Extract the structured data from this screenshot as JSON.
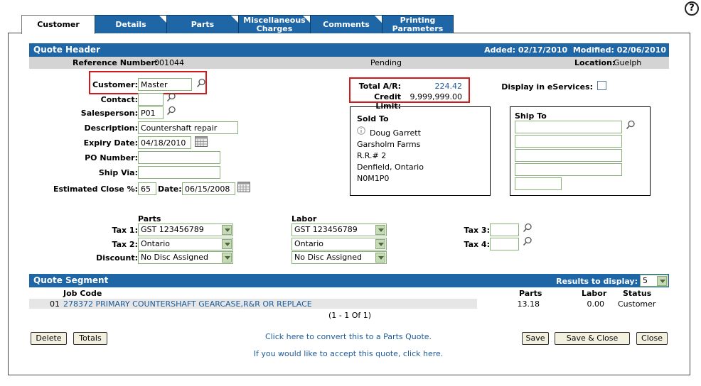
{
  "tabs": [
    {
      "label": "Customer"
    },
    {
      "label": "Details"
    },
    {
      "label": "Parts"
    },
    {
      "label": "Miscellaneous Charges"
    },
    {
      "label": "Comments"
    },
    {
      "label": "Printing Parameters"
    }
  ],
  "header": {
    "title": "Quote Header",
    "added_label": "Added:",
    "added_value": "02/17/2010",
    "modified_label": "Modified:",
    "modified_value": "02/06/2010",
    "reference_label": "Reference Number:",
    "reference_value": "001044",
    "status": "Pending",
    "location_label": "Location:",
    "location_value": "Guelph"
  },
  "form": {
    "customer_label": "Customer:",
    "customer_value": "Master",
    "contact_label": "Contact:",
    "contact_value": "",
    "salesperson_label": "Salesperson:",
    "salesperson_value": "P01",
    "description_label": "Description:",
    "description_value": "Countershaft repair",
    "expiry_label": "Expiry Date:",
    "expiry_value": "04/18/2010",
    "po_label": "PO Number:",
    "po_value": "",
    "shipvia_label": "Ship Via:",
    "shipvia_value": "",
    "estclose_label": "Estimated Close %:",
    "estclose_value": "65",
    "date_label": "Date:",
    "date_value": "06/15/2008"
  },
  "account": {
    "total_ar_label": "Total A/R:",
    "total_ar_value": "224.42",
    "credit_limit_label": "Credit Limit:",
    "credit_limit_value": "9,999,999.00",
    "eservices_label": "Display in eServices:"
  },
  "sold_to": {
    "title": "Sold To",
    "lines": [
      "Doug Garrett",
      "Garsholm Farms",
      "R.R.# 2",
      "Denfield, Ontario",
      "N0M1P0"
    ]
  },
  "ship_to": {
    "title": "Ship To"
  },
  "tax": {
    "parts_header": "Parts",
    "labor_header": "Labor",
    "tax1_label": "Tax 1:",
    "tax2_label": "Tax 2:",
    "discount_label": "Discount:",
    "tax3_label": "Tax 3:",
    "tax4_label": "Tax 4:",
    "parts_tax1": "GST 123456789",
    "parts_tax2": "Ontario",
    "parts_discount": "No Disc Assigned",
    "labor_tax1": "GST 123456789",
    "labor_tax2": "Ontario",
    "labor_discount": "No Disc Assigned"
  },
  "segment": {
    "title": "Quote Segment",
    "results_label": "Results to display:",
    "results_value": "5",
    "col_jobcode": "Job Code",
    "col_parts": "Parts",
    "col_labor": "Labor",
    "col_status": "Status",
    "rows": [
      {
        "num": "01",
        "code": "278372 PRIMARY COUNTERSHAFT GEARCASE,R&R OR REPLACE",
        "parts": "13.18",
        "labor": "0.00",
        "status": "Customer"
      }
    ],
    "pagination": "(1 - 1 Of 1)"
  },
  "footer": {
    "delete": "Delete",
    "totals": "Totals",
    "convert_link": "Click here to convert this to a Parts Quote.",
    "accept_link": "If you would like to accept this quote, click here.",
    "save": "Save",
    "save_close": "Save & Close",
    "close": "Close"
  }
}
